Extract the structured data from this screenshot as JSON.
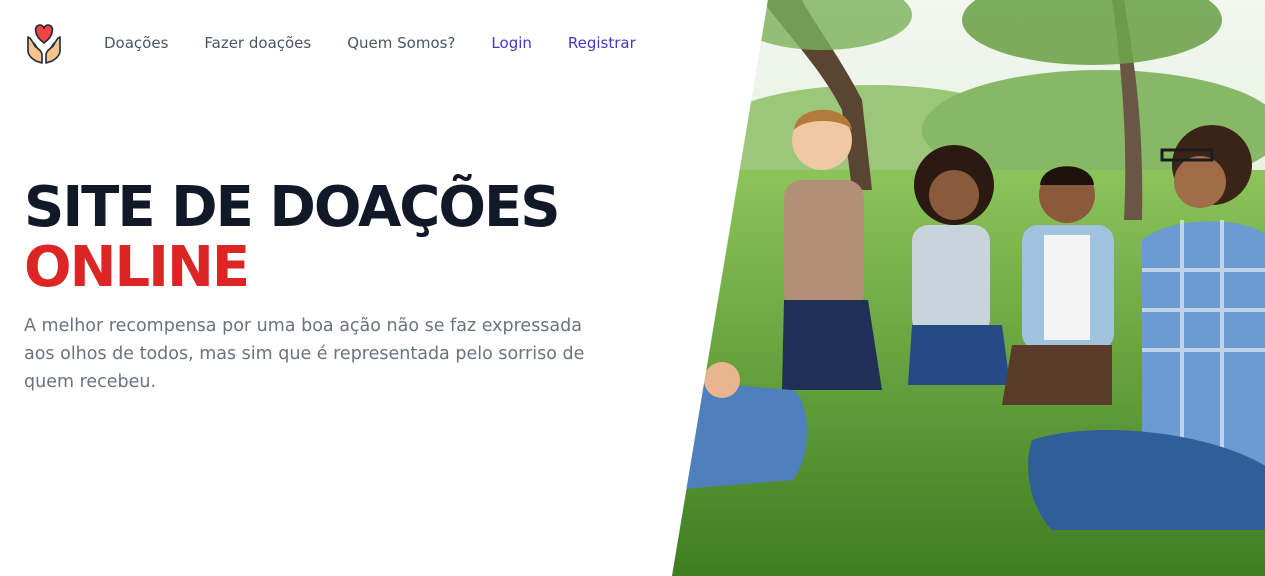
{
  "nav": {
    "logo_icon": "heart-in-hands-icon",
    "links": [
      "Doações",
      "Fazer doações",
      "Quem Somos?"
    ],
    "login": "Login",
    "register": "Registrar"
  },
  "hero": {
    "title_line1": "SITE DE DOAÇÕES",
    "title_line2": "ONLINE",
    "description": "A melhor recompensa por uma boa ação não se faz expressada aos olhos de todos, mas sim que é representada pelo sorriso de quem recebeu."
  },
  "colors": {
    "title": "#111827",
    "accent_red": "#dc2626",
    "link_accent": "#4338ca",
    "text_gray": "#6b7280"
  }
}
